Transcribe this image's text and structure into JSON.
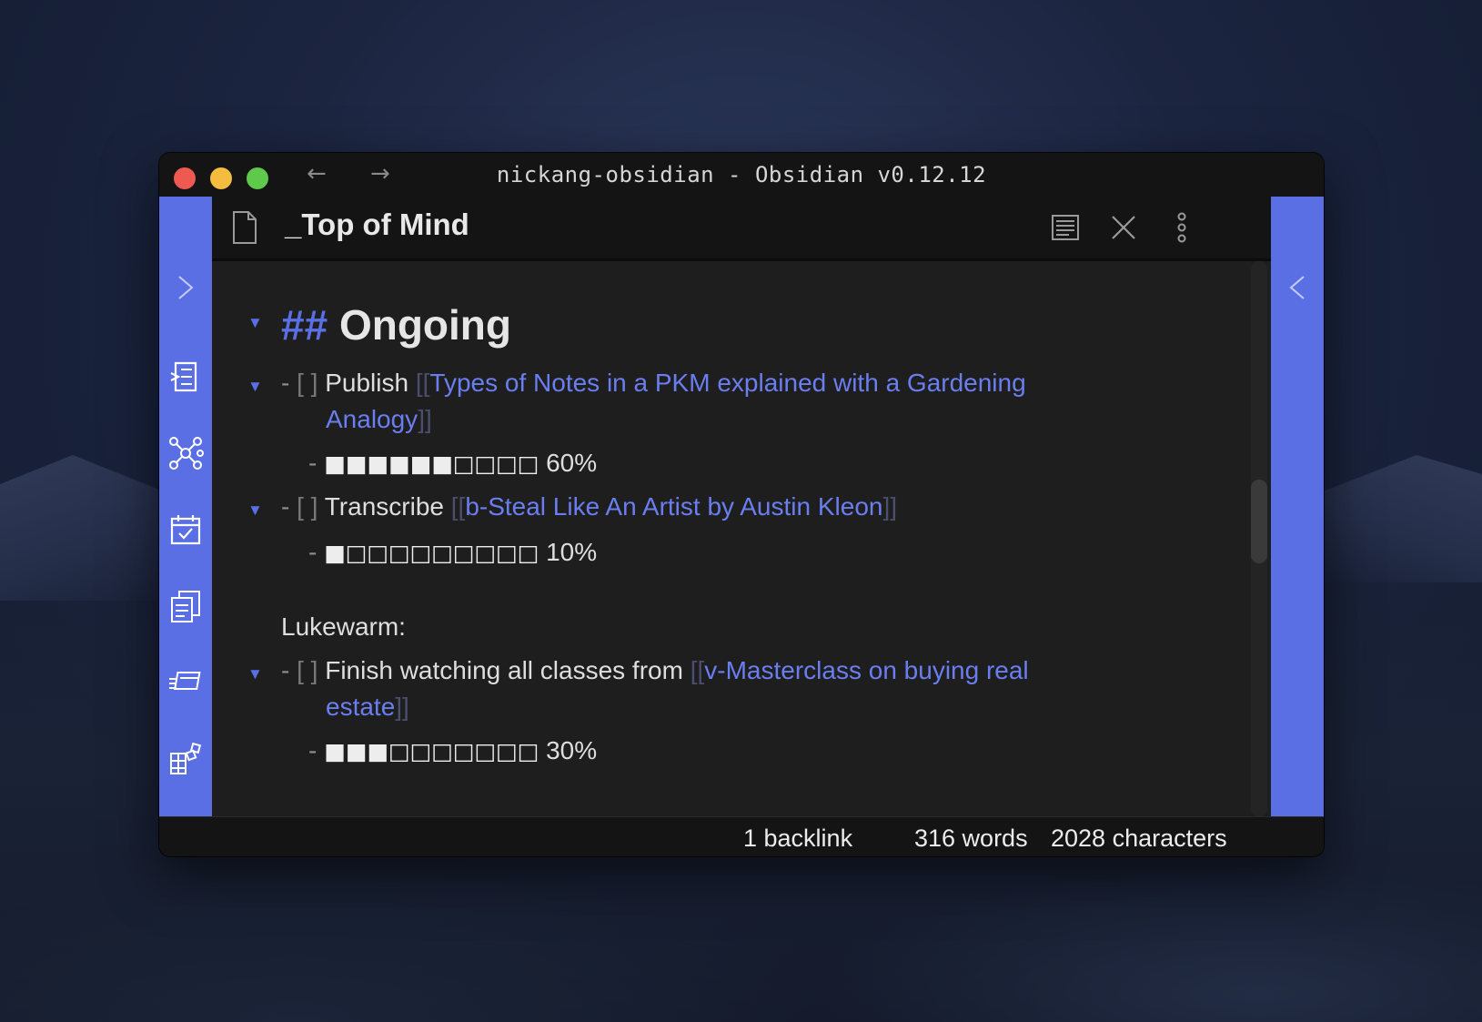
{
  "window": {
    "title": "nickang-obsidian - Obsidian v0.12.12",
    "nav_back": "←",
    "nav_forward": "→"
  },
  "colors": {
    "accent": "#5b6fe5",
    "link": "#6a7ef0",
    "background": "#1e1e1e"
  },
  "left_ribbon": {
    "icons": [
      "expand-sidebar-icon",
      "quick-switcher-icon",
      "graph-view-icon",
      "daily-note-icon",
      "templates-icon",
      "slides-icon",
      "plugins-icon"
    ]
  },
  "right_ribbon": {
    "icons": [
      "collapse-sidebar-icon"
    ]
  },
  "view": {
    "title": "_Top of Mind",
    "actions": [
      "reading-view-icon",
      "close-icon",
      "more-options-icon"
    ]
  },
  "note": {
    "heading_hashes": "##",
    "heading_text": "Ongoing",
    "tasks": [
      {
        "dash": "-",
        "checkbox": "[ ]",
        "verb": "Publish",
        "link_open": "[[",
        "link_line1": "Types of Notes in a PKM explained with a Gardening",
        "link_line2": "Analogy",
        "link_close": "]]",
        "progress_squares": "■■■■■■□□□□",
        "progress_label": "60%",
        "progress_value": 0.6
      },
      {
        "dash": "-",
        "checkbox": "[ ]",
        "verb": "Transcribe",
        "link_open": "[[",
        "link_line1": "b-Steal Like An Artist by Austin Kleon",
        "link_close": "]]",
        "progress_squares": "■□□□□□□□□□",
        "progress_label": "10%",
        "progress_value": 0.1
      }
    ],
    "lukewarm_label": "Lukewarm:",
    "lukewarm_tasks": [
      {
        "dash": "-",
        "checkbox": "[ ]",
        "verb": "Finish watching all classes from",
        "link_open": "[[",
        "link_line1": "v-Masterclass on buying real",
        "link_line2": "estate",
        "link_close": "]]",
        "progress_squares": "■■■□□□□□□□",
        "progress_label": "30%",
        "progress_value": 0.3
      }
    ]
  },
  "status_bar": {
    "backlinks": "1 backlink",
    "words": "316 words",
    "characters": "2028 characters"
  }
}
